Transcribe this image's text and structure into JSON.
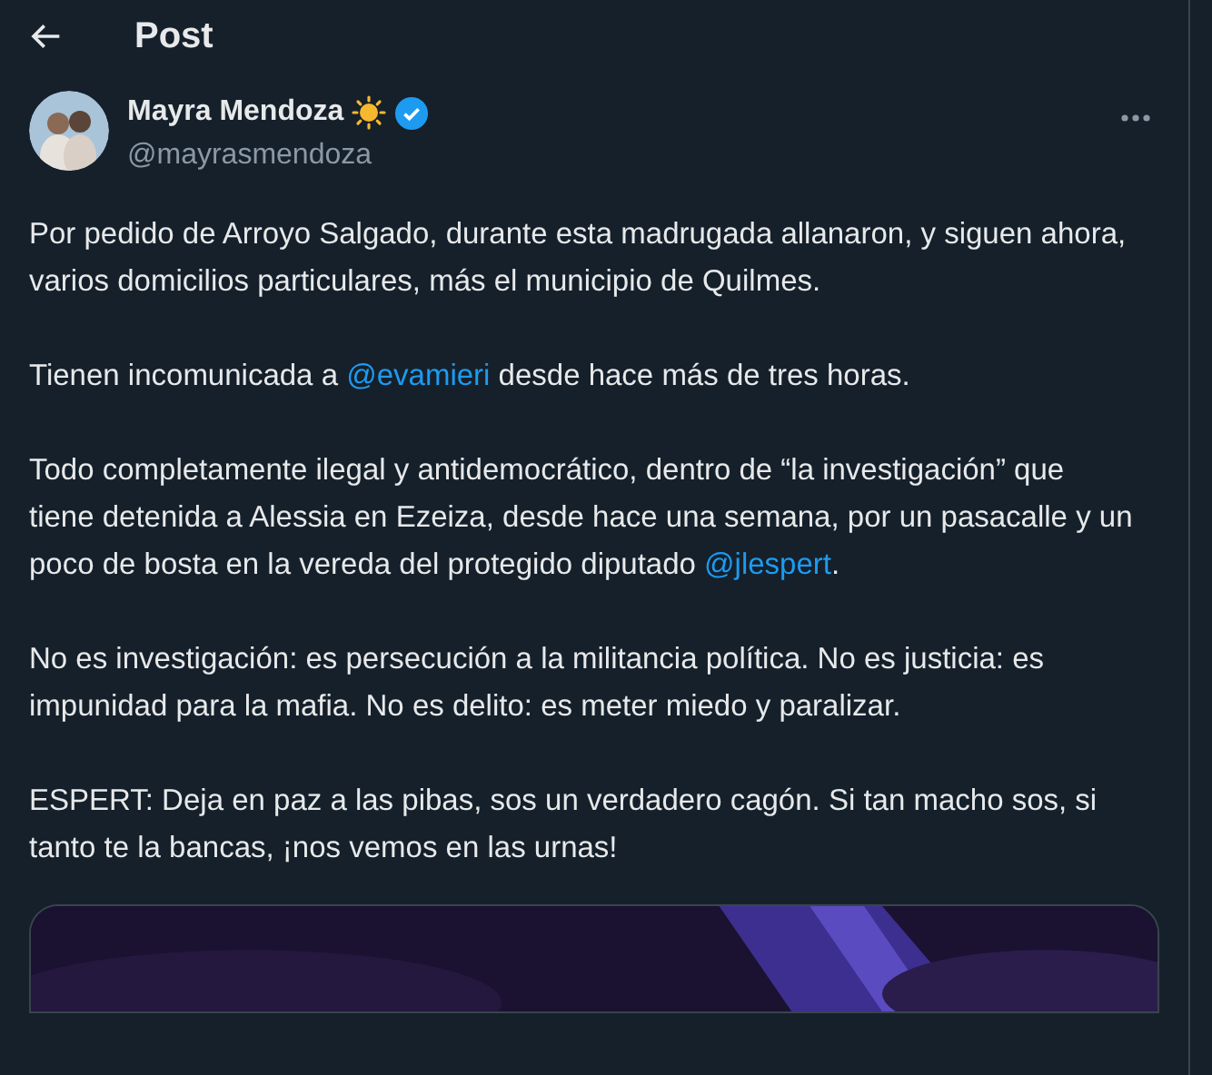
{
  "header": {
    "title": "Post"
  },
  "author": {
    "name": "Mayra Mendoza",
    "handle": "@mayrasmendoza",
    "verified": true
  },
  "paragraphs": [
    [
      {
        "kind": "text",
        "text": "Por pedido de Arroyo Salgado, durante esta madrugada allanaron, y siguen ahora, varios domicilios particulares, más el municipio de Quilmes."
      }
    ],
    [
      {
        "kind": "text",
        "text": "Tienen incomunicada a "
      },
      {
        "kind": "mention",
        "text": "@evamieri"
      },
      {
        "kind": "text",
        "text": " desde hace más de tres horas."
      }
    ],
    [
      {
        "kind": "text",
        "text": "Todo completamente ilegal y antidemocrático, dentro de “la investigación” que tiene detenida a Alessia en Ezeiza, desde hace una semana, por un pasacalle y un poco de bosta en la vereda del protegido diputado "
      },
      {
        "kind": "mention",
        "text": "@jlespert"
      },
      {
        "kind": "text",
        "text": "."
      }
    ],
    [
      {
        "kind": "text",
        "text": "No es investigación: es persecución a la militancia política. No es justicia: es impunidad para la mafia. No es delito: es meter miedo y paralizar."
      }
    ],
    [
      {
        "kind": "text",
        "text": "ESPERT: Deja en paz a las pibas, sos un verdadero cagón. Si tan macho sos, si tanto te la bancas, ¡nos vemos en las urnas!"
      }
    ]
  ]
}
